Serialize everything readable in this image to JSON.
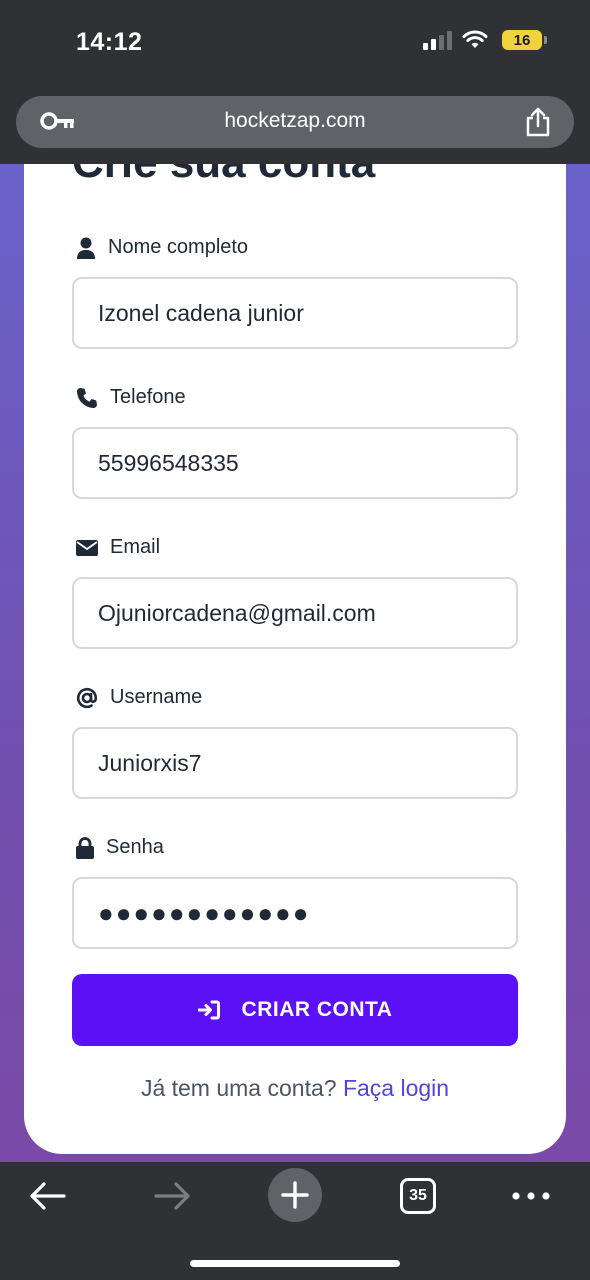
{
  "status_bar": {
    "time": "14:12",
    "battery": "16"
  },
  "browser": {
    "url": "hocketzap.com"
  },
  "card": {
    "title": "Crie sua conta"
  },
  "form": {
    "fields": [
      {
        "label": "Nome completo",
        "value": "Izonel cadena junior",
        "icon": "user-icon"
      },
      {
        "label": "Telefone",
        "value": "55996548335",
        "icon": "phone-icon"
      },
      {
        "label": "Email",
        "value": "Ojuniorcadena@gmail.com",
        "icon": "envelope-icon"
      },
      {
        "label": "Username",
        "value": "Juniorxis7",
        "icon": "at-icon"
      },
      {
        "label": "Senha",
        "value": "●●●●●●●●●●●●",
        "icon": "lock-icon"
      }
    ],
    "submit_label": "CRIAR CONTA",
    "login_prompt": "Já tem uma conta?",
    "login_link": "Faça login"
  },
  "bottom_bar": {
    "tab_count": "35"
  },
  "colors": {
    "accent": "#5b10f5",
    "link": "#4f46d9",
    "background_gradient_top": "#6a62c9",
    "background_gradient_bottom": "#7a4aa8"
  }
}
